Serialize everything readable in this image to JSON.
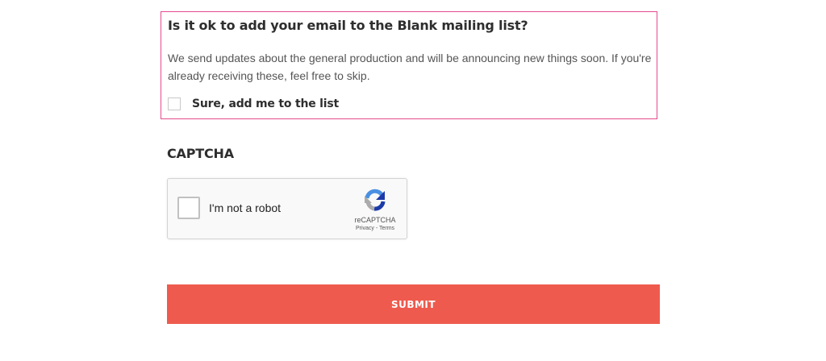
{
  "mailing": {
    "title": "Is it ok to add your email to the Blank mailing list?",
    "description": "We send updates about the general production and will be announcing new things soon. If you're already receiving these, feel free to skip.",
    "optin_label": "Sure, add me to the list",
    "optin_checked": false,
    "border_color": "#e54a8c"
  },
  "captcha": {
    "heading": "CAPTCHA",
    "checkbox_label": "I'm not a robot",
    "brand": "reCAPTCHA",
    "privacy_link": "Privacy",
    "separator": " - ",
    "terms_link": "Terms",
    "logo_icon": "recaptcha-logo-icon"
  },
  "form": {
    "submit_label": "SUBMIT",
    "submit_color": "#ee5b4e"
  }
}
